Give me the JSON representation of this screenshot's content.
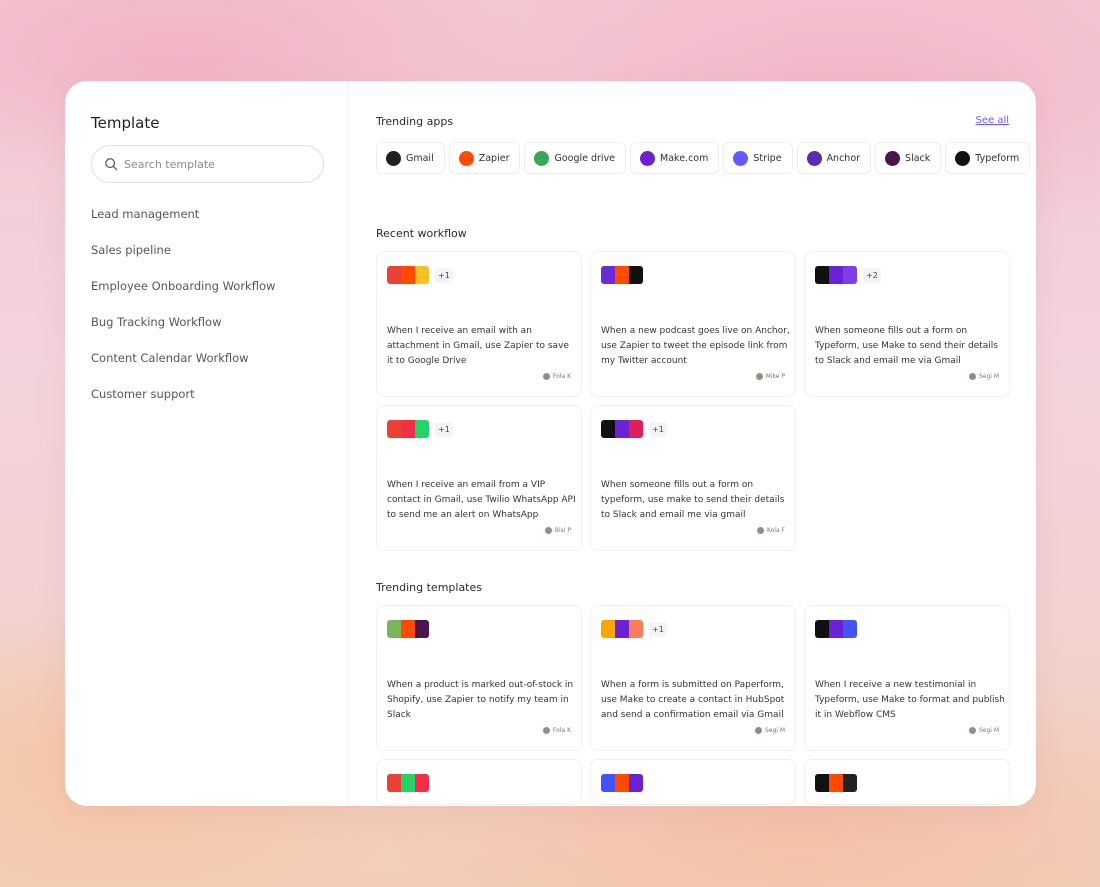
{
  "sidebar": {
    "title": "Template",
    "search_placeholder": "Search template",
    "items": [
      {
        "label": "Lead management"
      },
      {
        "label": "Sales pipeline"
      },
      {
        "label": "Employee Onboarding Workflow"
      },
      {
        "label": "Bug Tracking Workflow"
      },
      {
        "label": "Content Calendar Workflow"
      },
      {
        "label": "Customer support"
      }
    ]
  },
  "trending_apps": {
    "title": "Trending apps",
    "see_all": "See all",
    "apps": [
      {
        "name": "Gmail",
        "icon": "gmail-icon",
        "color": "#1f1f1f"
      },
      {
        "name": "Zapier",
        "icon": "zapier-icon",
        "color": "#ff4a00"
      },
      {
        "name": "Google drive",
        "icon": "google-drive-icon",
        "color": "#34a853"
      },
      {
        "name": "Make.com",
        "icon": "make-icon",
        "color": "#6b21d4"
      },
      {
        "name": "Stripe",
        "icon": "stripe-icon",
        "color": "#635bff"
      },
      {
        "name": "Anchor",
        "icon": "anchor-icon",
        "color": "#5a2bb5"
      },
      {
        "name": "Slack",
        "icon": "slack-icon",
        "color": "#4a154b"
      },
      {
        "name": "Typeform",
        "icon": "typeform-icon",
        "color": "#111111"
      }
    ]
  },
  "recent_workflow": {
    "title": "Recent workflow",
    "cards": [
      {
        "icons": [
          "#ea4335",
          "#ff4a00",
          "#f6c026"
        ],
        "extra": "+1",
        "text": "When I receive an email with an attachment in Gmail, use Zapier to save it to Google Drive",
        "author": "Fola K"
      },
      {
        "icons": [
          "#6b2bd6",
          "#ff4a00",
          "#111111"
        ],
        "extra": "",
        "text": "When a new podcast goes live on Anchor, use Zapier to tweet the episode link from my Twitter account",
        "author": "Mike P"
      },
      {
        "icons": [
          "#111111",
          "#6b21d4",
          "#7b3fe4"
        ],
        "extra": "+2",
        "text": "When someone fills out a form on Typeform, use Make to send their details to Slack and email me via Gmail",
        "author": "Segi M"
      },
      {
        "icons": [
          "#ea4335",
          "#f22f46",
          "#25d366"
        ],
        "extra": "+1",
        "text": "When I receive an email from a VIP contact in Gmail, use Twilio WhatsApp API to send me an alert on WhatsApp",
        "author": "Bisi P"
      },
      {
        "icons": [
          "#111111",
          "#6b21d4",
          "#e01e5a"
        ],
        "extra": "+1",
        "text": "When someone fills out a form on typeform, use make to send their details to Slack and email me via  gmail",
        "author": "Kola F"
      }
    ]
  },
  "trending_templates": {
    "title": "Trending templates",
    "cards": [
      {
        "icons": [
          "#7ab55c",
          "#ff4a00",
          "#4a154b"
        ],
        "extra": "",
        "text": "When a product is marked out-of-stock in Shopify, use Zapier to notify my team in Slack",
        "author": "Fola K"
      },
      {
        "icons": [
          "#f6a800",
          "#6b21d4",
          "#ff7a59"
        ],
        "extra": "+1",
        "text": "When a form is submitted on Paperform, use Make to create a contact in HubSpot and send a confirmation email via Gmail",
        "author": "Segi M"
      },
      {
        "icons": [
          "#111111",
          "#6b21d4",
          "#4353ff"
        ],
        "extra": "",
        "text": "When I receive a new testimonial in Typeform, use Make to format and publish it in Webflow CMS",
        "author": "Segi M"
      },
      {
        "icons": [
          "#ea4335",
          "#25d366",
          "#f22f46"
        ],
        "extra": "",
        "text": "",
        "author": ""
      },
      {
        "icons": [
          "#4353ff",
          "#ff4a00",
          "#6b21d4"
        ],
        "extra": "",
        "text": "",
        "author": ""
      },
      {
        "icons": [
          "#111111",
          "#ff4a00",
          "#222222"
        ],
        "extra": "",
        "text": "",
        "author": ""
      }
    ]
  }
}
